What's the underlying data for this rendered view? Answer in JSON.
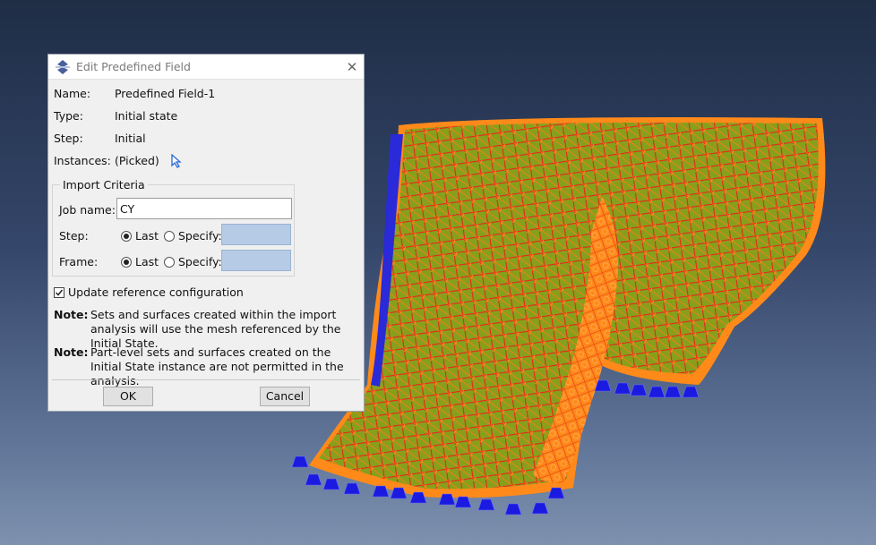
{
  "dialog": {
    "title": "Edit Predefined Field",
    "fields": {
      "name_label": "Name:",
      "name_value": "Predefined Field-1",
      "type_label": "Type:",
      "type_value": "Initial state",
      "step_label": "Step:",
      "step_value": "Initial",
      "instances_label": "Instances:",
      "instances_value": "(Picked)"
    },
    "import_criteria": {
      "legend": "Import Criteria",
      "job_name_label": "Job name:",
      "job_name_value": "CY",
      "step_label": "Step:",
      "frame_label": "Frame:",
      "last_label": "Last",
      "specify_label": "Specify:",
      "step_selected": "Last",
      "frame_selected": "Last"
    },
    "update_reference": {
      "label": "Update reference configuration",
      "checked": true
    },
    "notes": [
      {
        "label": "Note:",
        "text": "Sets and surfaces created within the import analysis will use the mesh referenced by the Initial State."
      },
      {
        "label": "Note:",
        "text": "Part-level sets and surfaces created on the Initial State instance are not permitted in the analysis."
      }
    ],
    "buttons": {
      "ok": "OK",
      "cancel": "Cancel"
    }
  },
  "colors": {
    "mesh_line": "#e8201a",
    "node_marker": "#ff8a1a",
    "element_fill": "#8aa21a",
    "boundary_marker": "#1a1ae0",
    "background_top": "#1f2d45",
    "background_bottom": "#7e91af"
  }
}
